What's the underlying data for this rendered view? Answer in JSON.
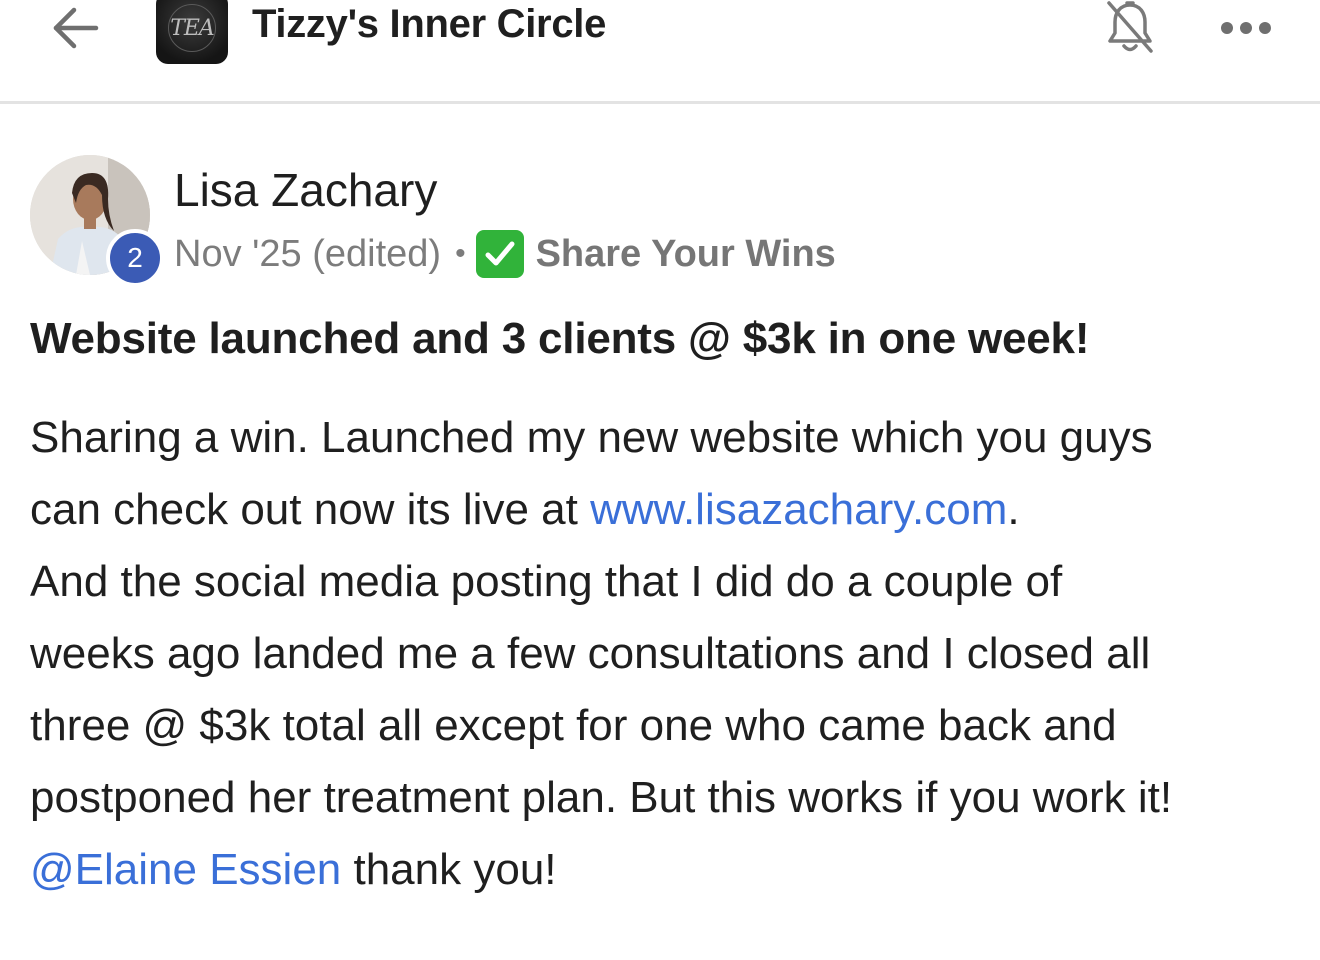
{
  "header": {
    "back_icon": "arrow-left-icon",
    "group_logo_text": "TEA",
    "group_title": "Tizzy's Inner Circle",
    "bell_icon": "bell-off-icon",
    "more_icon": "more-horizontal-icon"
  },
  "post": {
    "author": {
      "name": "Lisa Zachary",
      "level": "2"
    },
    "meta": {
      "date": "Nov '25 (edited)",
      "separator": "•",
      "category_icon": "check-mark-button-icon",
      "category": "Share Your Wins"
    },
    "title": "Website launched and 3 clients @ $3k in one week!",
    "body": {
      "line1": "Sharing a win. Launched my new website which you guys",
      "line2_prefix": "can check out now its live at ",
      "link": "www.lisazachary.com",
      "line2_suffix": ".",
      "line3": "And the social media posting that I did do a couple of",
      "line4": "weeks ago landed me a few consultations and I closed all",
      "line5": "three @ $3k total all except for one who came back and",
      "line6": "postponed her treatment plan. But this works if you work it!",
      "mention": "@Elaine Essien",
      "line7_suffix": " thank you!"
    }
  },
  "colors": {
    "link": "#3a6fd8",
    "badge": "#3b5bb5",
    "check": "#31b33a",
    "meta_text": "#7c7c7c"
  }
}
